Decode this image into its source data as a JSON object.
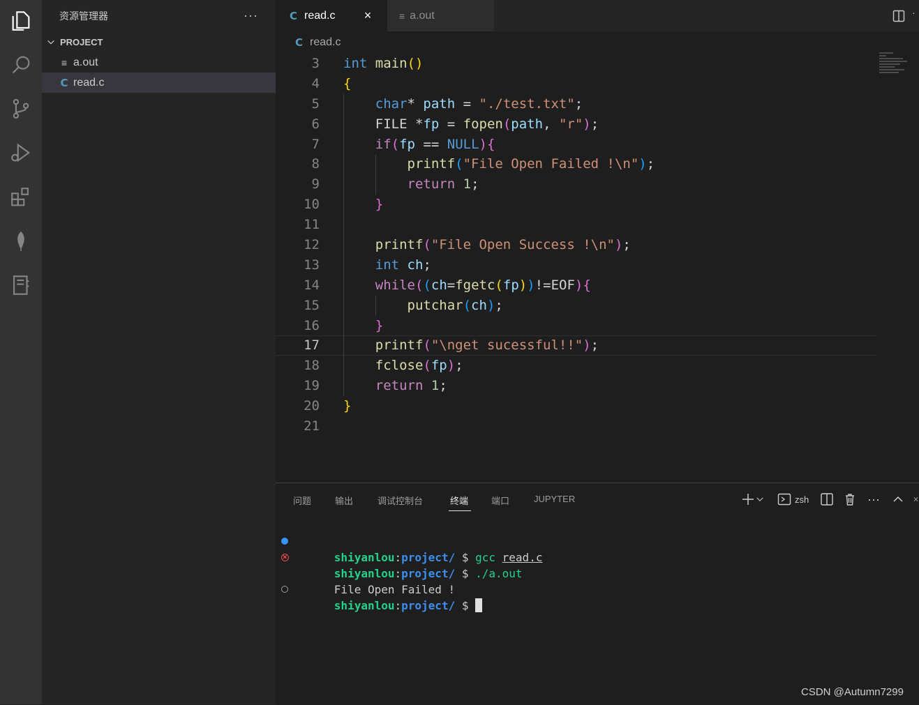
{
  "activity_bar": {
    "icons": [
      "explorer-icon",
      "search-icon",
      "source-control-icon",
      "run-debug-icon",
      "extensions-icon",
      "leaf-icon",
      "notebook-icon"
    ]
  },
  "sidebar": {
    "title": "资源管理器",
    "more_glyph": "···",
    "project_label": "PROJECT",
    "files": [
      {
        "name": "a.out",
        "icon": "lines-file-icon",
        "selected": false
      },
      {
        "name": "read.c",
        "icon": "c-file-icon",
        "selected": true
      }
    ]
  },
  "tabs": [
    {
      "label": "read.c",
      "icon_text": "C",
      "active": true,
      "close_glyph": "×"
    },
    {
      "label": "a.out",
      "icon_text": "≡",
      "active": false
    }
  ],
  "breadcrumb": {
    "icon_text": "C",
    "file": "read.c"
  },
  "editor": {
    "current_line": 17,
    "lines": [
      {
        "n": "3",
        "tokens": [
          [
            "int",
            "kw"
          ],
          [
            " ",
            "plain"
          ],
          [
            "main",
            "fn"
          ],
          [
            "()",
            "b1"
          ]
        ]
      },
      {
        "n": "4",
        "tokens": [
          [
            "{",
            "b1"
          ]
        ]
      },
      {
        "n": "5",
        "tokens": [
          [
            "    ",
            "plain"
          ],
          [
            "char",
            "kw"
          ],
          [
            "* ",
            "plain"
          ],
          [
            "path",
            "var"
          ],
          [
            " = ",
            "plain"
          ],
          [
            "\"./test.txt\"",
            "str"
          ],
          [
            ";",
            "plain"
          ]
        ]
      },
      {
        "n": "6",
        "tokens": [
          [
            "    ",
            "plain"
          ],
          [
            "FILE",
            "plain"
          ],
          [
            " *",
            "plain"
          ],
          [
            "fp",
            "var"
          ],
          [
            " = ",
            "plain"
          ],
          [
            "fopen",
            "fn"
          ],
          [
            "(",
            "b2"
          ],
          [
            "path",
            "var"
          ],
          [
            ", ",
            "plain"
          ],
          [
            "\"r\"",
            "str"
          ],
          [
            ")",
            "b2"
          ],
          [
            ";",
            "plain"
          ]
        ]
      },
      {
        "n": "7",
        "tokens": [
          [
            "    ",
            "plain"
          ],
          [
            "if",
            "ctl"
          ],
          [
            "(",
            "b2"
          ],
          [
            "fp",
            "var"
          ],
          [
            " == ",
            "plain"
          ],
          [
            "NULL",
            "kw"
          ],
          [
            ")",
            "b2"
          ],
          [
            "{",
            "b2"
          ]
        ]
      },
      {
        "n": "8",
        "tokens": [
          [
            "        ",
            "plain"
          ],
          [
            "printf",
            "fn"
          ],
          [
            "(",
            "b3"
          ],
          [
            "\"File Open Failed !\\n\"",
            "str"
          ],
          [
            ")",
            "b3"
          ],
          [
            ";",
            "plain"
          ]
        ]
      },
      {
        "n": "9",
        "tokens": [
          [
            "        ",
            "plain"
          ],
          [
            "return",
            "ctl"
          ],
          [
            " ",
            "plain"
          ],
          [
            "1",
            "num"
          ],
          [
            ";",
            "plain"
          ]
        ]
      },
      {
        "n": "10",
        "tokens": [
          [
            "    ",
            "plain"
          ],
          [
            "}",
            "b2"
          ]
        ]
      },
      {
        "n": "11",
        "tokens": []
      },
      {
        "n": "12",
        "tokens": [
          [
            "    ",
            "plain"
          ],
          [
            "printf",
            "fn"
          ],
          [
            "(",
            "b2"
          ],
          [
            "\"File Open Success !\\n\"",
            "str"
          ],
          [
            ")",
            "b2"
          ],
          [
            ";",
            "plain"
          ]
        ]
      },
      {
        "n": "13",
        "tokens": [
          [
            "    ",
            "plain"
          ],
          [
            "int",
            "kw"
          ],
          [
            " ",
            "plain"
          ],
          [
            "ch",
            "var"
          ],
          [
            ";",
            "plain"
          ]
        ]
      },
      {
        "n": "14",
        "tokens": [
          [
            "    ",
            "plain"
          ],
          [
            "while",
            "ctl"
          ],
          [
            "(",
            "b2"
          ],
          [
            "(",
            "b3"
          ],
          [
            "ch",
            "var"
          ],
          [
            "=",
            "plain"
          ],
          [
            "fgetc",
            "fn"
          ],
          [
            "(",
            "b1"
          ],
          [
            "fp",
            "var"
          ],
          [
            ")",
            "b1"
          ],
          [
            ")",
            "b3"
          ],
          [
            "!=",
            "plain"
          ],
          [
            "EOF",
            "plain"
          ],
          [
            ")",
            "b2"
          ],
          [
            "{",
            "b2"
          ]
        ]
      },
      {
        "n": "15",
        "tokens": [
          [
            "        ",
            "plain"
          ],
          [
            "putchar",
            "fn"
          ],
          [
            "(",
            "b3"
          ],
          [
            "ch",
            "var"
          ],
          [
            ")",
            "b3"
          ],
          [
            ";",
            "plain"
          ]
        ]
      },
      {
        "n": "16",
        "tokens": [
          [
            "    ",
            "plain"
          ],
          [
            "}",
            "b2"
          ]
        ]
      },
      {
        "n": "17",
        "tokens": [
          [
            "    ",
            "plain"
          ],
          [
            "printf",
            "fn"
          ],
          [
            "(",
            "b2"
          ],
          [
            "\"\\nget sucessful!!\"",
            "str"
          ],
          [
            ")",
            "b2"
          ],
          [
            ";",
            "plain"
          ]
        ]
      },
      {
        "n": "18",
        "tokens": [
          [
            "    ",
            "plain"
          ],
          [
            "fclose",
            "fn"
          ],
          [
            "(",
            "b2"
          ],
          [
            "fp",
            "var"
          ],
          [
            ")",
            "b2"
          ],
          [
            ";",
            "plain"
          ]
        ]
      },
      {
        "n": "19",
        "tokens": [
          [
            "    ",
            "plain"
          ],
          [
            "return",
            "ctl"
          ],
          [
            " ",
            "plain"
          ],
          [
            "1",
            "num"
          ],
          [
            ";",
            "plain"
          ]
        ]
      },
      {
        "n": "20",
        "tokens": [
          [
            "}",
            "b1"
          ]
        ]
      },
      {
        "n": "21",
        "tokens": []
      }
    ]
  },
  "panel": {
    "tabs": [
      {
        "label": "问题",
        "active": false
      },
      {
        "label": "输出",
        "active": false
      },
      {
        "label": "调试控制台",
        "active": false
      },
      {
        "label": "终端",
        "active": true
      },
      {
        "label": "端口",
        "active": false
      },
      {
        "label": "JUPYTER",
        "active": false
      }
    ],
    "shell_label": "zsh",
    "more_glyph": "···"
  },
  "terminal": {
    "lines": [
      {
        "marker": "blue",
        "user": "shiyanlou",
        "colon": ":",
        "dir": "project/",
        "dollar": " $ ",
        "cmd": "gcc",
        "arg": "read.c"
      },
      {
        "marker": "red",
        "user": "shiyanlou",
        "colon": ":",
        "dir": "project/",
        "dollar": " $ ",
        "cmd": "./a.out",
        "arg": ""
      },
      {
        "marker": "none",
        "output": "File Open Failed !"
      },
      {
        "marker": "gray",
        "user": "shiyanlou",
        "colon": ":",
        "dir": "project/",
        "dollar": " $",
        "cmd": "",
        "arg": "",
        "cursor": true
      }
    ]
  },
  "watermark": "CSDN @Autumn7299",
  "colors": {
    "accent": "#3794ff",
    "keyword": "#569cd6",
    "control": "#c586c0",
    "function": "#dcdcaa",
    "string": "#ce9178"
  }
}
